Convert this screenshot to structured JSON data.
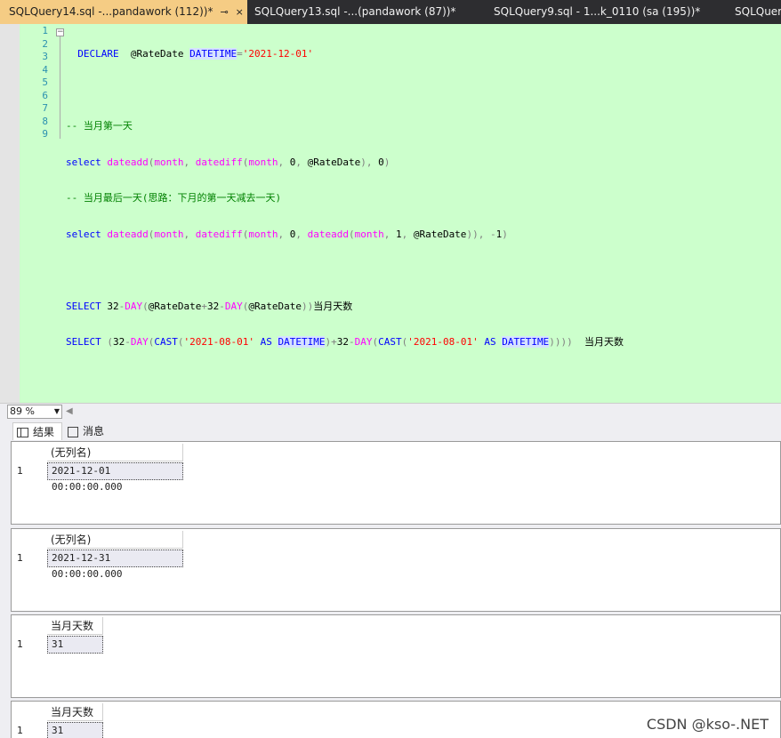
{
  "tabs": [
    {
      "label": "SQLQuery14.sql -...pandawork (112))*",
      "active": true
    },
    {
      "label": "SQLQuery13.sql -...(pandawork (87))*",
      "active": false
    },
    {
      "label": "SQLQuery9.sql - 1...k_0110 (sa (195))*",
      "active": false
    },
    {
      "label": "SQLQuery",
      "active": false
    }
  ],
  "tab_pin_glyph": "⊸",
  "tab_close_glyph": "×",
  "line_numbers": [
    "1",
    "2",
    "3",
    "4",
    "5",
    "6",
    "7",
    "8",
    "9"
  ],
  "code": [
    "DECLARE  @RateDate DATETIME='2021-12-01'",
    "",
    "-- 当月第一天",
    "select dateadd(month, datediff(month, 0, @RateDate), 0)",
    "-- 当月最后一天(思路：下月的第一天减去一天)",
    "select dateadd(month, datediff(month, 0, dateadd(month, 1, @RateDate)), -1)",
    "",
    "SELECT 32-DAY(@RateDate+32-DAY(@RateDate))当月天数",
    "SELECT (32-DAY(CAST('2021-08-01' AS DATETIME)+32-DAY(CAST('2021-08-01' AS DATETIME))))  当月天数"
  ],
  "zoom": "89 %",
  "results_tabs": [
    {
      "label": "结果",
      "icon": "grid-icon",
      "active": true
    },
    {
      "label": "消息",
      "icon": "message-icon",
      "active": false
    }
  ],
  "results": [
    {
      "header": "(无列名)",
      "rows": [
        {
          "n": "1",
          "value": "2021-12-01 00:00:00.000"
        }
      ]
    },
    {
      "header": "(无列名)",
      "rows": [
        {
          "n": "1",
          "value": "2021-12-31 00:00:00.000"
        }
      ]
    },
    {
      "header": "当月天数",
      "rows": [
        {
          "n": "1",
          "value": "31"
        }
      ]
    },
    {
      "header": "当月天数",
      "rows": [
        {
          "n": "1",
          "value": "31"
        }
      ]
    }
  ],
  "watermark": "CSDN @kso-.NET"
}
